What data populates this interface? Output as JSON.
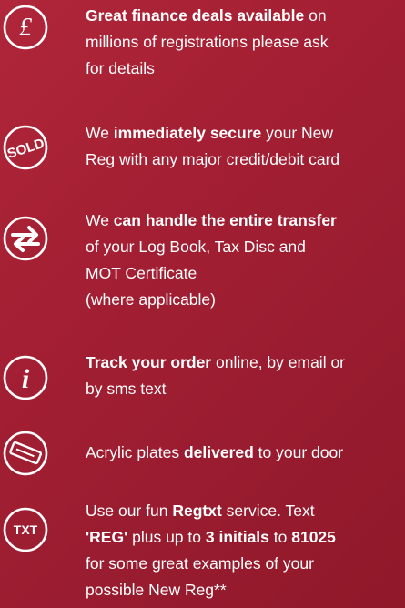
{
  "features": [
    {
      "icon": "pound-sign-icon",
      "lines": [
        [
          {
            "t": "Great finance deals available",
            "b": true
          },
          {
            "t": " on"
          }
        ],
        [
          {
            "t": "millions of registrations please ask"
          }
        ],
        [
          {
            "t": "for details"
          }
        ]
      ]
    },
    {
      "icon": "sold-stamp-icon",
      "lines": [
        [
          {
            "t": "We "
          },
          {
            "t": "immediately secure",
            "b": true
          },
          {
            "t": " your New"
          }
        ],
        [
          {
            "t": "Reg with any major credit/debit card"
          }
        ]
      ]
    },
    {
      "icon": "transfer-arrows-icon",
      "lines": [
        [
          {
            "t": "We "
          },
          {
            "t": "can handle the entire transfer",
            "b": true
          }
        ],
        [
          {
            "t": "of your Log Book, Tax Disc and"
          }
        ],
        [
          {
            "t": "MOT Certificate"
          }
        ],
        [
          {
            "t": "(where applicable)"
          }
        ]
      ]
    },
    {
      "icon": "info-icon",
      "lines": [
        [
          {
            "t": "Track your order",
            "b": true
          },
          {
            "t": " online, by email or"
          }
        ],
        [
          {
            "t": "by sms text"
          }
        ]
      ]
    },
    {
      "icon": "number-plate-icon",
      "lines": [
        [
          {
            "t": "Acrylic plates "
          },
          {
            "t": "delivered",
            "b": true
          },
          {
            "t": " to your door"
          }
        ]
      ]
    },
    {
      "icon": "txt-icon",
      "lines": [
        [
          {
            "t": "Use our fun "
          },
          {
            "t": "Regtxt",
            "b": true
          },
          {
            "t": " service. Text"
          }
        ],
        [
          {
            "t": "'REG'",
            "b": true
          },
          {
            "t": " plus up to "
          },
          {
            "t": "3 initials",
            "b": true
          },
          {
            "t": " to "
          },
          {
            "t": "81025",
            "b": true
          }
        ],
        [
          {
            "t": "for some great examples of your"
          }
        ],
        [
          {
            "t": "possible New Reg**"
          }
        ]
      ]
    }
  ],
  "icons": {
    "pound_symbol": "£",
    "sold_text": "SOLD",
    "info_symbol": "i",
    "txt_text": "TXT"
  },
  "colors": {
    "background": "#a41f33",
    "text": "#ffffff",
    "icon_stroke": "#ffffff"
  }
}
